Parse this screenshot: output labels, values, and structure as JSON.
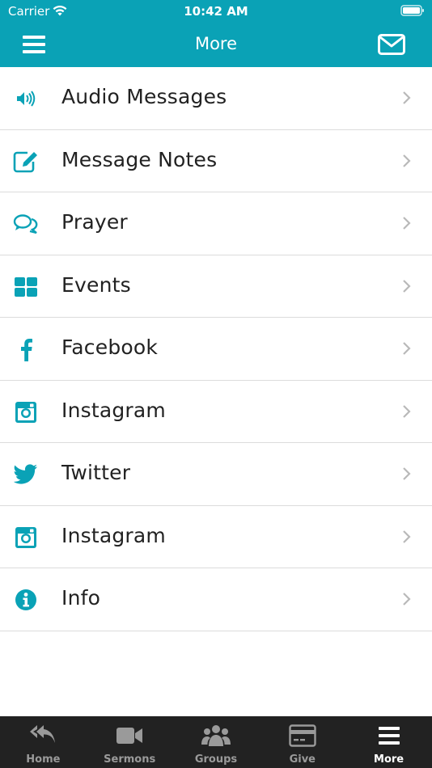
{
  "status_bar": {
    "carrier": "Carrier",
    "time": "10:42 AM"
  },
  "nav": {
    "title": "More"
  },
  "colors": {
    "accent": "#0aa2b6",
    "tab_bar": "#222222",
    "tab_inactive": "#9a9a9a",
    "tab_active": "#ffffff"
  },
  "menu_items": [
    {
      "label": "Audio Messages",
      "icon": "speaker-icon"
    },
    {
      "label": "Message Notes",
      "icon": "edit-note-icon"
    },
    {
      "label": "Prayer",
      "icon": "chat-bubbles-icon"
    },
    {
      "label": "Events",
      "icon": "grid-icon"
    },
    {
      "label": "Facebook",
      "icon": "facebook-icon"
    },
    {
      "label": "Instagram",
      "icon": "instagram-icon"
    },
    {
      "label": "Twitter",
      "icon": "twitter-icon"
    },
    {
      "label": "Instagram",
      "icon": "instagram-icon"
    },
    {
      "label": "Info",
      "icon": "info-icon"
    }
  ],
  "tabs": [
    {
      "label": "Home",
      "icon": "reply-all-icon",
      "active": false
    },
    {
      "label": "Sermons",
      "icon": "video-camera-icon",
      "active": false
    },
    {
      "label": "Groups",
      "icon": "users-icon",
      "active": false
    },
    {
      "label": "Give",
      "icon": "credit-card-icon",
      "active": false
    },
    {
      "label": "More",
      "icon": "hamburger-icon",
      "active": true
    }
  ]
}
